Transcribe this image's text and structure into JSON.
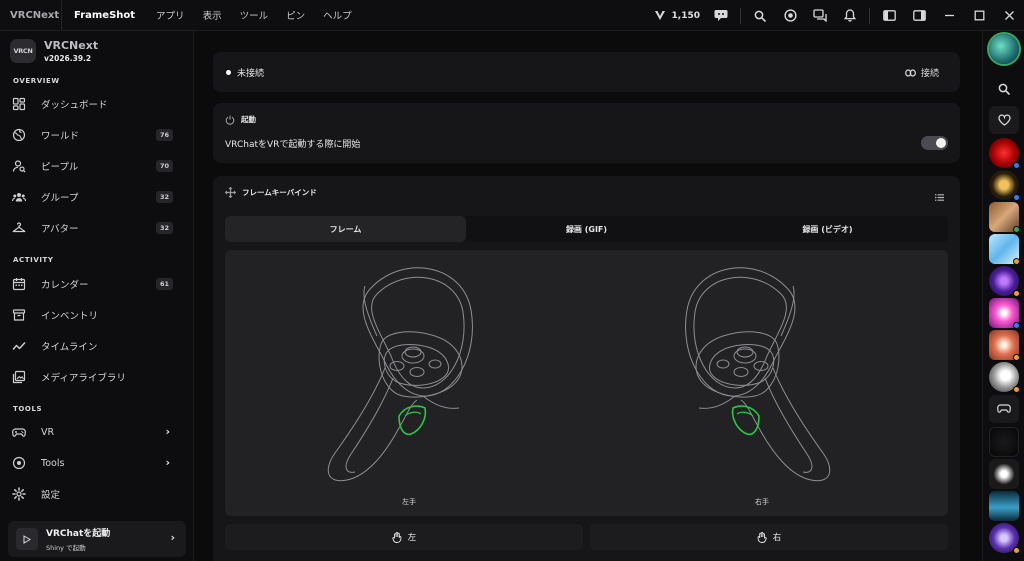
{
  "titlebar": {
    "app_name": "VRCNext",
    "plugin_name": "FrameShot",
    "menus": [
      "アプリ",
      "表示",
      "ツール",
      "ピン",
      "ヘルプ"
    ],
    "credits": "1,150"
  },
  "sidebar": {
    "brand_logo": "VRCN",
    "brand_name": "VRCNext",
    "version": "v2026.39.2",
    "sections": {
      "overview": "OVERVIEW",
      "activity": "ACTIVITY",
      "tools": "TOOLS"
    },
    "overview_items": [
      {
        "label": "ダッシュボード",
        "icon": "dashboard-icon"
      },
      {
        "label": "ワールド",
        "icon": "world-icon",
        "badge": "76"
      },
      {
        "label": "ピープル",
        "icon": "people-icon",
        "badge": "70"
      },
      {
        "label": "グループ",
        "icon": "group-icon",
        "badge": "32"
      },
      {
        "label": "アバター",
        "icon": "hanger-icon",
        "badge": "32"
      }
    ],
    "activity_items": [
      {
        "label": "カレンダー",
        "icon": "calendar-icon",
        "badge": "61"
      },
      {
        "label": "インベントリ",
        "icon": "inventory-icon"
      },
      {
        "label": "タイムライン",
        "icon": "timeline-icon"
      },
      {
        "label": "メディアライブラリ",
        "icon": "media-library-icon"
      }
    ],
    "tools_items": [
      {
        "label": "VR",
        "icon": "gamepad-icon"
      },
      {
        "label": "Tools",
        "icon": "tools-icon"
      },
      {
        "label": "設定",
        "icon": "gear-icon"
      }
    ],
    "launch": {
      "title": "VRChatを起動",
      "subtitle": "Shiny で起動"
    }
  },
  "main": {
    "status": {
      "text": "未接続",
      "connect_label": "接続"
    },
    "startup": {
      "heading": "起動",
      "label": "VRChatをVRで起動する際に開始",
      "enabled": true
    },
    "keybind": {
      "heading": "フレームキーバインド",
      "tabs": [
        "フレーム",
        "録画 (GIF)",
        "録画 (ビデオ)"
      ],
      "active_tab": 0,
      "left_label": "左手",
      "right_label": "右手",
      "left_button": "左",
      "right_button": "右",
      "highlight_color": "#27c93f"
    }
  },
  "rail": {
    "status_colors": {
      "online": "#3ba55d",
      "busy": "#2d7ff9",
      "away": "#f0a020"
    }
  }
}
